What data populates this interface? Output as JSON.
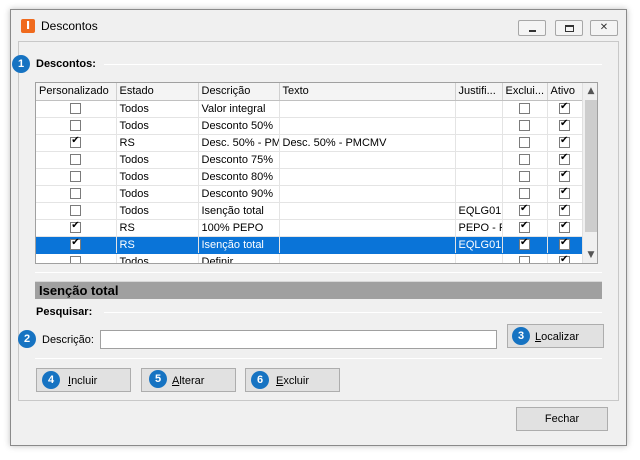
{
  "window": {
    "title": "Descontos",
    "app_icon_letter": "I"
  },
  "badges": [
    "1",
    "2",
    "3",
    "4",
    "5",
    "6"
  ],
  "section_descontos": "Descontos:",
  "grid": {
    "columns": [
      "Personalizado",
      "Estado",
      "Descrição",
      "Texto",
      "Justifi...",
      "Exclui...",
      "Ativo"
    ],
    "rows": [
      {
        "personalizado": false,
        "estado": "Todos",
        "descricao": "Valor integral",
        "texto": "",
        "justif": "",
        "exclui": false,
        "ativo": true,
        "selected": false
      },
      {
        "personalizado": false,
        "estado": "Todos",
        "descricao": "Desconto 50%",
        "texto": "",
        "justif": "",
        "exclui": false,
        "ativo": true,
        "selected": false
      },
      {
        "personalizado": true,
        "estado": "RS",
        "descricao": "Desc. 50% - PM",
        "texto": "Desc. 50% - PMCMV",
        "justif": "",
        "exclui": false,
        "ativo": true,
        "selected": false
      },
      {
        "personalizado": false,
        "estado": "Todos",
        "descricao": "Desconto 75%",
        "texto": "",
        "justif": "",
        "exclui": false,
        "ativo": true,
        "selected": false
      },
      {
        "personalizado": false,
        "estado": "Todos",
        "descricao": "Desconto 80%",
        "texto": "",
        "justif": "",
        "exclui": false,
        "ativo": true,
        "selected": false
      },
      {
        "personalizado": false,
        "estado": "Todos",
        "descricao": "Desconto 90%",
        "texto": "",
        "justif": "",
        "exclui": false,
        "ativo": true,
        "selected": false
      },
      {
        "personalizado": false,
        "estado": "Todos",
        "descricao": "Isenção total",
        "texto": "",
        "justif": "EQLG01",
        "exclui": true,
        "ativo": true,
        "selected": false
      },
      {
        "personalizado": true,
        "estado": "RS",
        "descricao": "100% PEPO",
        "texto": "",
        "justif": "PEPO - P",
        "exclui": true,
        "ativo": true,
        "selected": false
      },
      {
        "personalizado": true,
        "estado": "RS",
        "descricao": "Isenção total",
        "texto": "",
        "justif": "EQLG01",
        "exclui": true,
        "ativo": true,
        "selected": true
      },
      {
        "personalizado": false,
        "estado": "Todos",
        "descricao": "Definir",
        "texto": "",
        "justif": "",
        "exclui": false,
        "ativo": true,
        "selected": false
      }
    ]
  },
  "detail_title": "Isenção total",
  "section_pesquisar": "Pesquisar:",
  "search": {
    "label": "Descrição:",
    "value": "",
    "localizar_label": "Localizar"
  },
  "actions": {
    "incluir_label": "Incluir",
    "alterar_label": "Alterar",
    "excluir_label": "Excluir"
  },
  "fechar_label": "Fechar",
  "colors": {
    "badge": "#1673c2",
    "selection": "#0a74d8",
    "app_icon": "#f06a1d",
    "info_bar": "#a0a0a0"
  }
}
